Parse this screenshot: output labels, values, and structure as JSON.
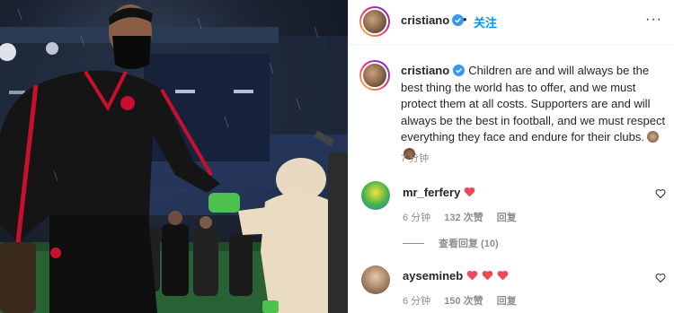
{
  "post_header": {
    "username": "cristiano",
    "dot": "•",
    "follow_label": "关注",
    "more_label": "···"
  },
  "caption": {
    "username": "cristiano",
    "text": "Children are and will always be the best thing the world has to offer, and we must protect them at all costs. Supporters are and will always be the best in football, and we must respect everything they face and endure for their clubs.",
    "time": "7 分钟"
  },
  "comments": [
    {
      "username": "mr_ferfery",
      "time": "6 分钟",
      "likes": "132 次赞",
      "reply_label": "回复",
      "view_replies": "查看回复 (10)"
    },
    {
      "username": "aysemineb",
      "time": "6 分钟",
      "likes": "150 次赞",
      "reply_label": "回复"
    }
  ],
  "colors": {
    "link_blue": "#0095f6",
    "heart_red": "#ed4956",
    "verified_blue": "#3897f0"
  }
}
